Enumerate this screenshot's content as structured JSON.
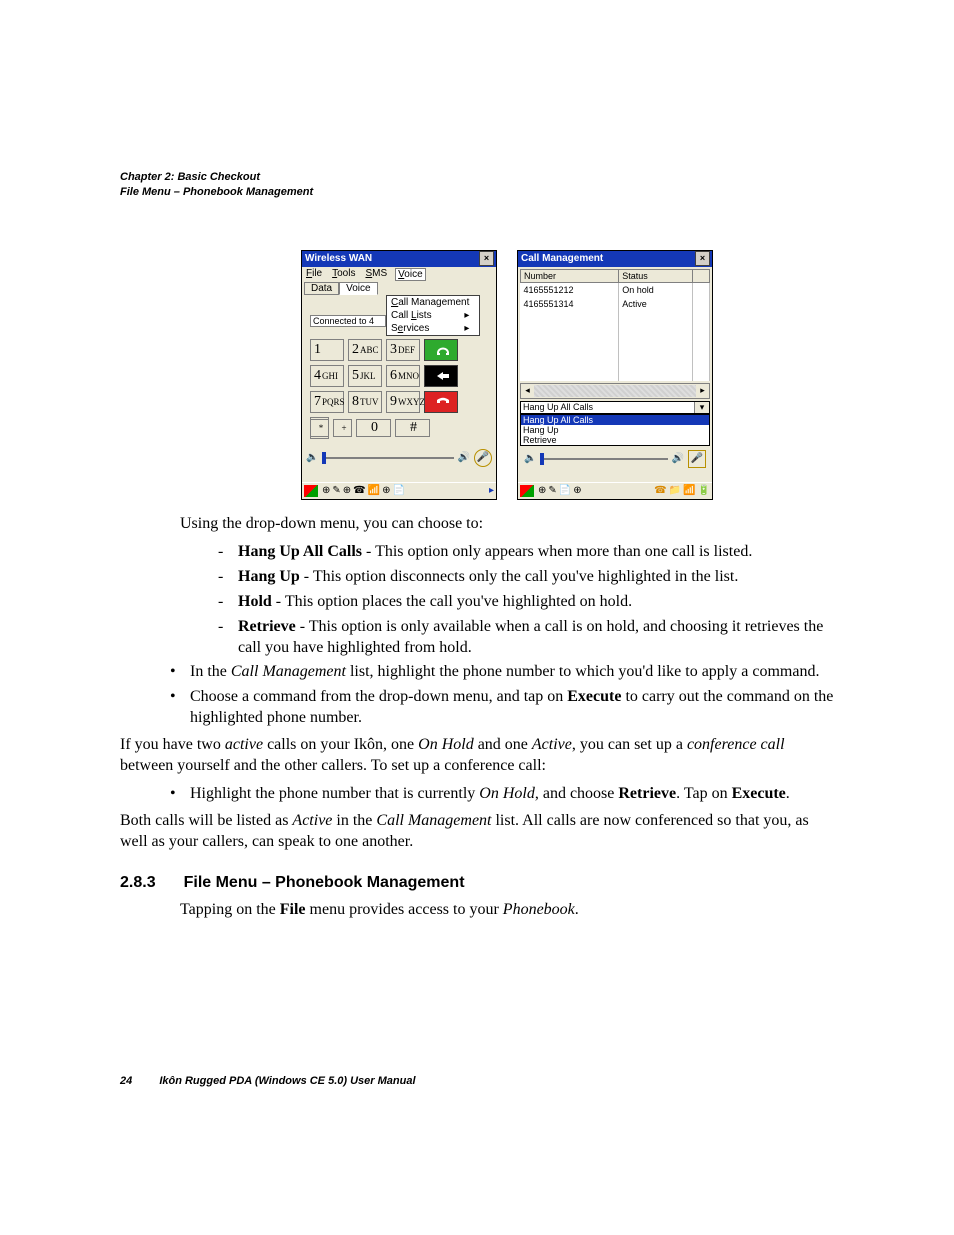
{
  "header": {
    "line1": "Chapter 2: Basic Checkout",
    "line2": "File Menu – Phonebook Management"
  },
  "left_window": {
    "title": "Wireless WAN",
    "menu": {
      "file": "File",
      "tools": "Tools",
      "sms": "SMS",
      "voice": "Voice"
    },
    "tabs": {
      "data": "Data",
      "voice": "Voice"
    },
    "voice_submenu": {
      "call_mgmt": "Call Management",
      "call_lists": "Call Lists",
      "services": "Services"
    },
    "connected": "Connected to 4",
    "keys": {
      "k1": "1",
      "k2": "2",
      "k2s": "ABC",
      "k3": "3",
      "k3s": "DEF",
      "k4": "4",
      "k4s": "GHI",
      "k5": "5",
      "k5s": "JKL",
      "k6": "6",
      "k6s": "MNO",
      "k7": "7",
      "k7s": "PQRS",
      "k8": "8",
      "k8s": "TUV",
      "k9": "9",
      "k9s": "WXYZ",
      "star": "*",
      "plus": "+",
      "k0": "0",
      "hash": "#"
    }
  },
  "right_window": {
    "title": "Call Management",
    "columns": {
      "number": "Number",
      "status": "Status"
    },
    "rows": [
      {
        "number": "4165551212",
        "status": "On hold"
      },
      {
        "number": "4165551314",
        "status": "Active"
      }
    ],
    "dropdown_selected": "Hang Up All Calls",
    "dropdown_options": {
      "o1": "Hang Up All Calls",
      "o2": "Hang Up",
      "o3": "Retrieve"
    }
  },
  "text": {
    "p1": "Using the drop-down menu, you can choose to:",
    "d1_b": "Hang Up All Calls",
    "d1_r": " - This option only appears when more than one call is listed.",
    "d2_b": "Hang Up",
    "d2_r": " - This option disconnects only the call you've highlighted in the list.",
    "d3_b": "Hold",
    "d3_r": " - This option places the call you've highlighted on hold.",
    "d4_b": "Retrieve",
    "d4_r": " - This option is only available when a call is on hold, and choosing it retrieves the call you have highlighted from hold.",
    "b1_pre": "In the ",
    "b1_i": "Call Management",
    "b1_post": " list, highlight the phone number to which you'd like to apply a command.",
    "b2_pre": "Choose a command from the drop-down menu, and tap on ",
    "b2_b": "Execute",
    "b2_post": " to carry out the command on the highlighted phone number.",
    "p2_1": "If you have two ",
    "p2_i1": "active",
    "p2_2": " calls on your Ikôn, one ",
    "p2_i2": "On Hold",
    "p2_3": " and one ",
    "p2_i3": "Active",
    "p2_4": ", you can set up a ",
    "p2_i4": "conference call",
    "p2_5": " between yourself and the other callers. To set up a conference call:",
    "b3_1": "Highlight the phone number that is currently ",
    "b3_i": "On Hold",
    "b3_2": ", and choose ",
    "b3_b1": "Retrieve",
    "b3_3": ". Tap on ",
    "b3_b2": "Execute",
    "b3_4": ".",
    "p3_1": "Both calls will be listed as ",
    "p3_i1": "Active",
    "p3_2": " in the ",
    "p3_i2": "Call Management",
    "p3_3": " list. All calls are now conferenced so that you, as well as your callers, can speak to one another.",
    "sec_num": "2.8.3",
    "sec_title": "File Menu – Phonebook Management",
    "p4_1": "Tapping on the ",
    "p4_b": "File",
    "p4_2": " menu provides access to your ",
    "p4_i": "Phonebook",
    "p4_3": "."
  },
  "footer": {
    "page": "24",
    "title": "Ikôn Rugged PDA (Windows CE 5.0) User Manual"
  }
}
